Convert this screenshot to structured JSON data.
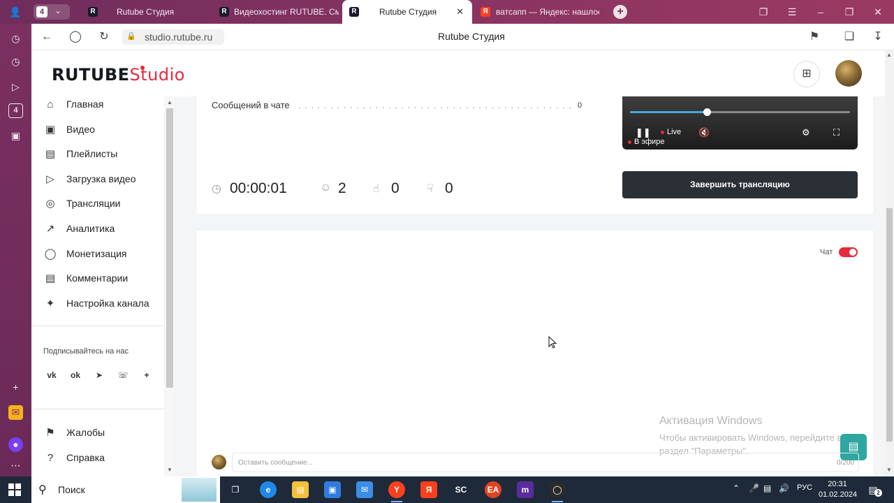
{
  "browser": {
    "tab_count": "4",
    "tabs": [
      {
        "label": "Rutube Студия",
        "favicon": "R"
      },
      {
        "label": "Видеохостинг RUTUBE. Смотр",
        "favicon": "R"
      },
      {
        "label": "Rutube Студия",
        "favicon": "R",
        "active": true
      },
      {
        "label": "ватсапп — Яндекс: нашлось",
        "favicon": "Я"
      }
    ],
    "url": "studio.rutube.ru",
    "page_title": "Rutube Студия"
  },
  "header": {
    "logo_main": "RUTUBE",
    "logo_studio": "Studio"
  },
  "sidebar": {
    "items": [
      {
        "label": "Главная",
        "icon": "home-icon"
      },
      {
        "label": "Видео",
        "icon": "video-icon"
      },
      {
        "label": "Плейлисты",
        "icon": "playlist-icon"
      },
      {
        "label": "Загрузка видео",
        "icon": "upload-icon"
      },
      {
        "label": "Трансляции",
        "icon": "broadcast-icon"
      },
      {
        "label": "Аналитика",
        "icon": "analytics-icon"
      },
      {
        "label": "Монетизация",
        "icon": "monetization-icon"
      },
      {
        "label": "Комментарии",
        "icon": "comments-icon"
      },
      {
        "label": "Настройка канала",
        "icon": "settings-wand-icon"
      }
    ],
    "follow_label": "Подписывайтесь на нас",
    "social": [
      "VK",
      "OK",
      "Telegram",
      "Viber",
      "More"
    ],
    "bottom_items": [
      {
        "label": "Жалобы",
        "icon": "flag-icon"
      },
      {
        "label": "Справка",
        "icon": "help-icon"
      }
    ]
  },
  "stream": {
    "chat_messages_label": "Сообщений в чате",
    "chat_messages_value": "0",
    "duration": "00:00:01",
    "viewers": "2",
    "likes": "0",
    "dislikes": "0",
    "player": {
      "live_label": "Live",
      "on_air_label": "В эфире",
      "progress": 0.35
    },
    "end_button": "Завершить трансляцию"
  },
  "chat": {
    "toggle_label": "Чат",
    "enabled": true,
    "placeholder": "Оставить сообщение...",
    "counter": "0/200"
  },
  "watermark": {
    "title": "Активация Windows",
    "text": "Чтобы активировать Windows, перейдите в раздел \"Параметры\"."
  },
  "taskbar": {
    "search_label": "Поиск",
    "lang": "РУС",
    "time": "20:31",
    "date": "01.02.2024",
    "notifications": "2"
  },
  "colors": {
    "accent": "#e8293f",
    "dark_button": "#2b2f36",
    "browser_frame": "#7a3060"
  }
}
